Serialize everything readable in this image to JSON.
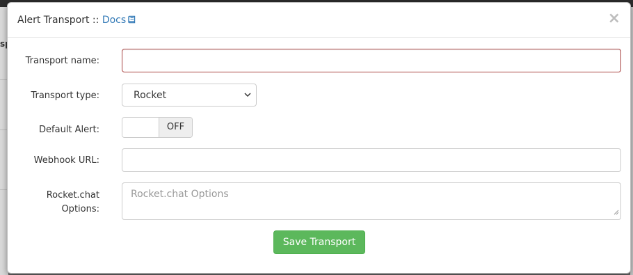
{
  "modal": {
    "title": "Alert Transport",
    "title_separator": " :: ",
    "docs_link": "Docs",
    "close_symbol": "×"
  },
  "form": {
    "transport_name": {
      "label": "Transport name:",
      "value": ""
    },
    "transport_type": {
      "label": "Transport type:",
      "selected": "Rocket"
    },
    "default_alert": {
      "label": "Default Alert:",
      "state": "OFF"
    },
    "webhook_url": {
      "label": "Webhook URL:",
      "value": ""
    },
    "rocket_options": {
      "label_line1": "Rocket.chat",
      "label_line2": "Options:",
      "placeholder": "Rocket.chat Options"
    },
    "save_button": "Save Transport"
  },
  "background": {
    "left_mark": "sp"
  },
  "colors": {
    "link": "#337ab7",
    "error_border": "#a94442",
    "save_button": "#5cb85c"
  },
  "icons": {
    "docs": "book-icon",
    "close": "close-icon",
    "select": "chevron-down-icon"
  }
}
